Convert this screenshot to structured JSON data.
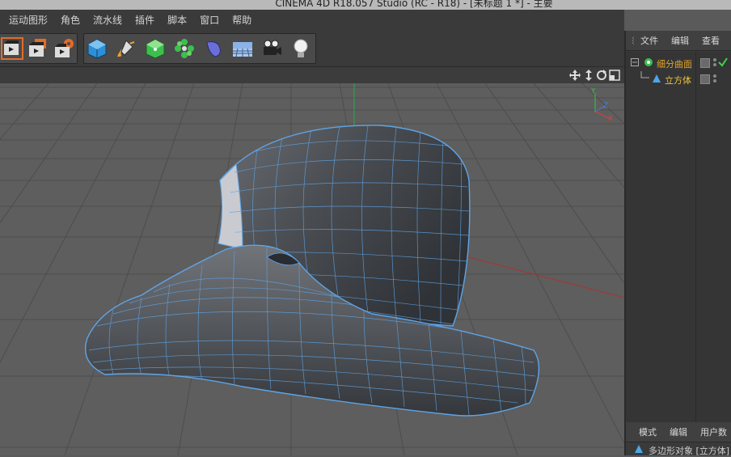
{
  "window": {
    "title": "CINEMA 4D R18.057 Studio (RC - R18) - [未标题 1 *] - 主要"
  },
  "menu": {
    "items": [
      "运动图形",
      "角色",
      "流水线",
      "插件",
      "脚本",
      "窗口",
      "帮助"
    ]
  },
  "toolbar": {
    "icons": [
      "render-view-icon",
      "render-picture-viewer-icon",
      "render-settings-icon",
      "cube-icon",
      "pen-spline-icon",
      "subdivision-surface-icon",
      "cloner-icon",
      "deformer-bend-icon",
      "floor-environment-icon",
      "camera-icon",
      "light-icon"
    ]
  },
  "viewport": {
    "nav_icons": [
      "move-view-icon",
      "zoom-view-icon",
      "rotate-view-icon",
      "maximize-view-icon"
    ],
    "axis": {
      "y": "Y",
      "z": "Z",
      "x": "X"
    }
  },
  "object_manager": {
    "tabs": [
      "文件",
      "编辑",
      "查看"
    ],
    "objects": [
      {
        "name": "细分曲面",
        "color": "#e2a32a",
        "icon": "subdivision-surface-icon",
        "checked": true
      },
      {
        "name": "立方体",
        "color": "#f0c040",
        "icon": "polygon-object-icon",
        "checked": false
      }
    ]
  },
  "attribute_manager": {
    "tabs": [
      "模式",
      "编辑",
      "用户数"
    ],
    "selection": "多边形对象 [立方体]"
  }
}
